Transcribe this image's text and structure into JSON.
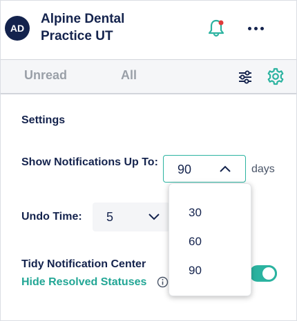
{
  "header": {
    "avatar_initials": "AD",
    "practice_name": "Alpine Dental Practice UT",
    "bell_icon": "bell-notification-icon",
    "more_icon": "more-horizontal-icon"
  },
  "tabs": {
    "unread_label": "Unread",
    "all_label": "All",
    "filter_icon": "sliders-icon",
    "settings_icon": "gear-icon"
  },
  "settings": {
    "title": "Settings",
    "show_notifications_label": "Show Notifications Up To:",
    "days_value": "90",
    "days_unit": "days",
    "undo_time_label": "Undo Time:",
    "undo_time_value": "5",
    "tidy_label": "Tidy Notification Center",
    "hide_resolved_label": "Hide Resolved Statuses",
    "hide_resolved_enabled": true
  },
  "dropdown": {
    "options": [
      "30",
      "60",
      "90"
    ]
  },
  "colors": {
    "accent": "#2bb3a0",
    "navy": "#14234d",
    "muted": "#9aa0a8"
  }
}
